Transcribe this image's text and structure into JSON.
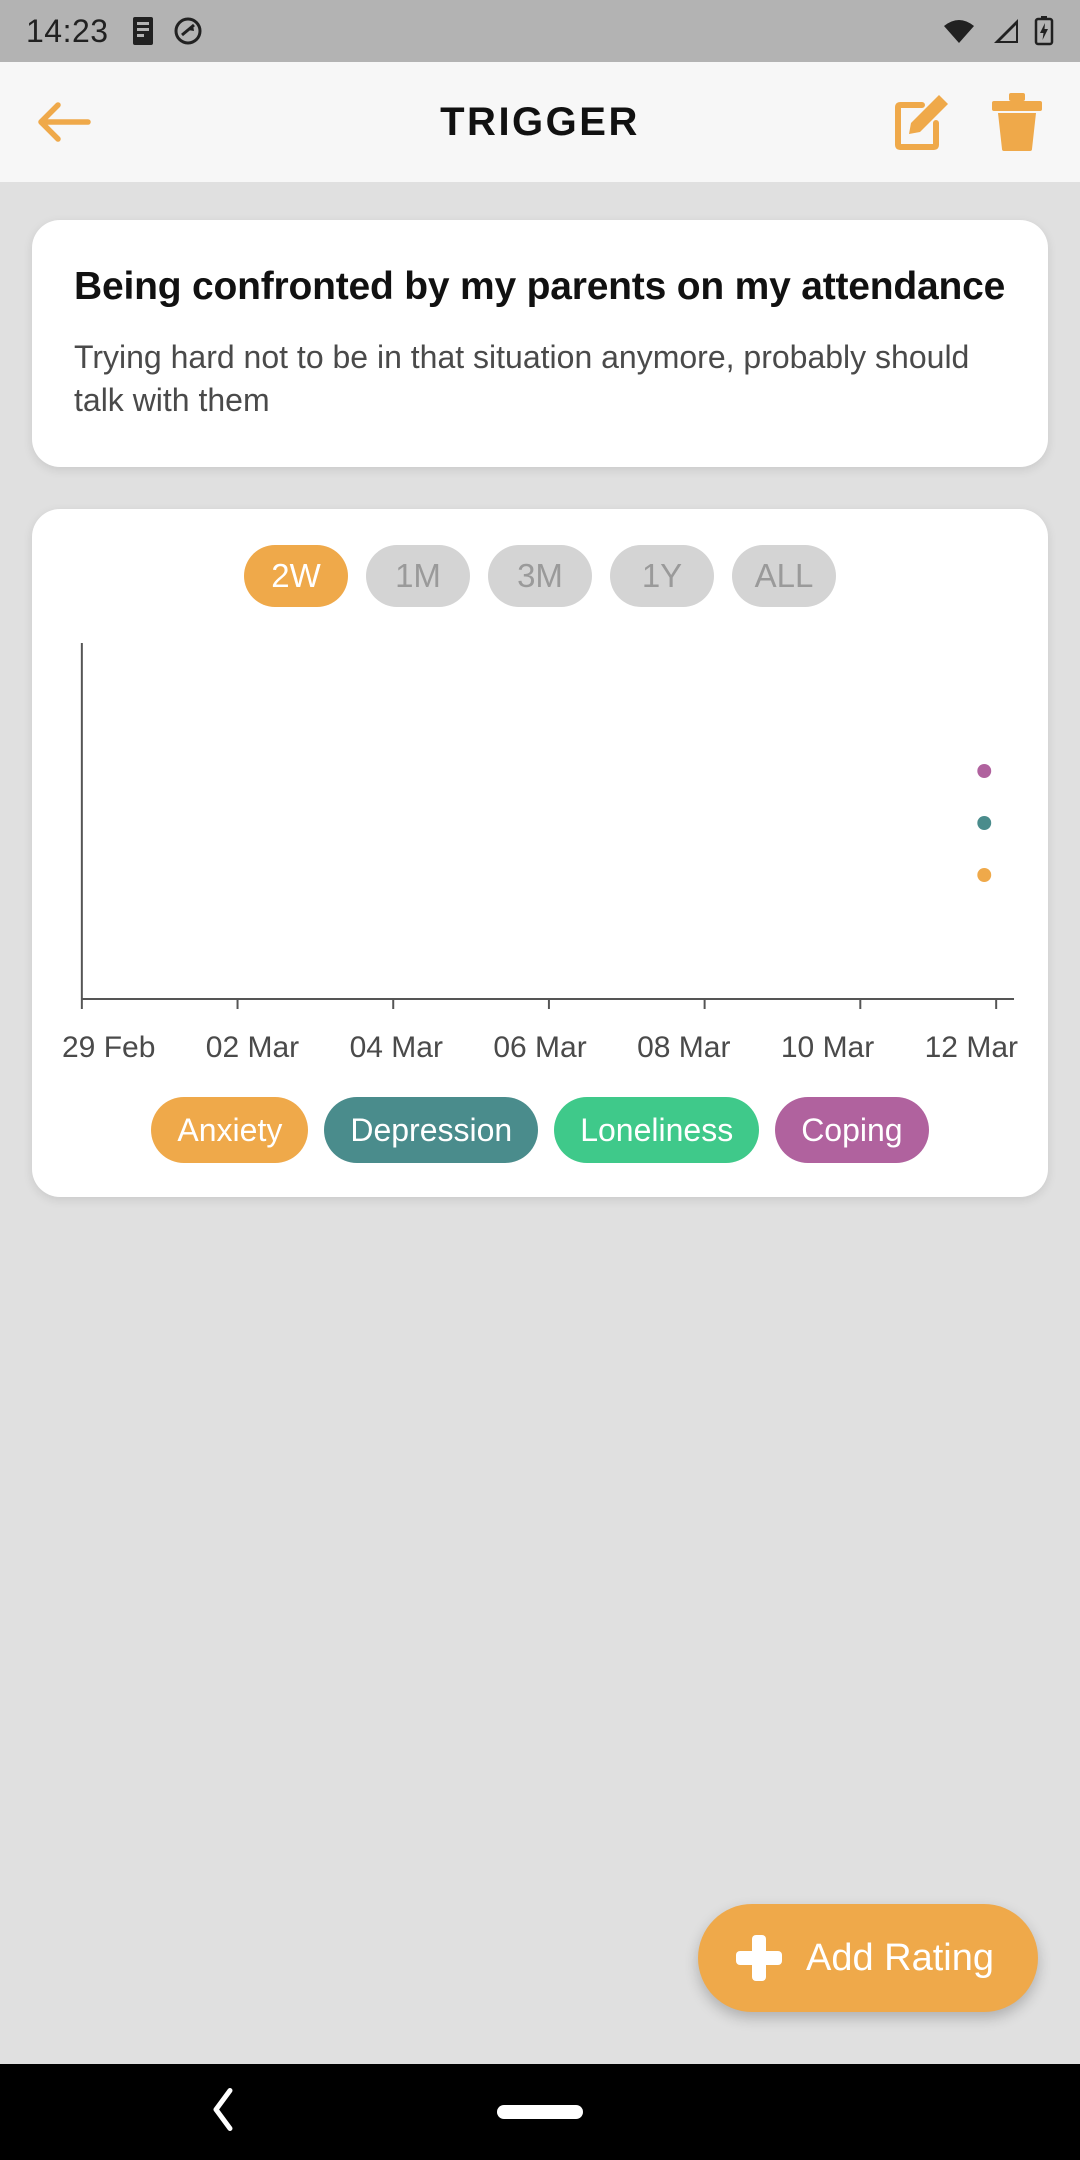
{
  "statusbar": {
    "time": "14:23",
    "left_icons": [
      "notes-notification-icon",
      "sync-disabled-icon"
    ],
    "right_icons": [
      "wifi-icon",
      "cellular-signal-icon",
      "battery-charging-icon"
    ]
  },
  "appbar": {
    "title": "TRIGGER",
    "back_icon": "back-arrow-icon",
    "edit_icon": "edit-icon",
    "delete_icon": "trash-icon",
    "accent": "#efa94a",
    "background": "#f7f7f7"
  },
  "trigger": {
    "title": "Being confronted by my parents on my attendance",
    "description": "Trying hard not to be in that situation anymore, probably should talk with them"
  },
  "ranges": [
    {
      "label": "2W",
      "active": true
    },
    {
      "label": "1M",
      "active": false
    },
    {
      "label": "3M",
      "active": false
    },
    {
      "label": "1Y",
      "active": false
    },
    {
      "label": "ALL",
      "active": false
    }
  ],
  "legend": [
    {
      "label": "Anxiety",
      "color": "#efa94a"
    },
    {
      "label": "Depression",
      "color": "#4a8c8c"
    },
    {
      "label": "Loneliness",
      "color": "#3fc98a"
    },
    {
      "label": "Coping",
      "color": "#b0629e"
    }
  ],
  "fab": {
    "label": "Add Rating",
    "icon": "plus-icon",
    "color": "#efa94a"
  },
  "navbar": {
    "back_icon": "nav-back-icon",
    "home_pill": "nav-home-pill"
  },
  "chart_data": {
    "type": "scatter",
    "title": "",
    "xlabel": "",
    "ylabel": "",
    "grid": false,
    "legend_position": "bottom",
    "x_tick_labels": [
      "29 Feb",
      "02 Mar",
      "04 Mar",
      "06 Mar",
      "08 Mar",
      "10 Mar",
      "12 Mar"
    ],
    "xlim": [
      "29 Feb",
      "13 Mar"
    ],
    "ylim": [
      0,
      10
    ],
    "series": [
      {
        "name": "Coping",
        "color": "#b0629e",
        "x": [
          "13 Mar"
        ],
        "y": [
          6.4
        ]
      },
      {
        "name": "Depression",
        "color": "#4a8c8c",
        "x": [
          "13 Mar"
        ],
        "y": [
          5.2
        ]
      },
      {
        "name": "Anxiety",
        "color": "#efa94a",
        "x": [
          "13 Mar"
        ],
        "y": [
          4.0
        ]
      },
      {
        "name": "Loneliness",
        "color": "#3fc98a",
        "x": [],
        "y": []
      }
    ]
  }
}
